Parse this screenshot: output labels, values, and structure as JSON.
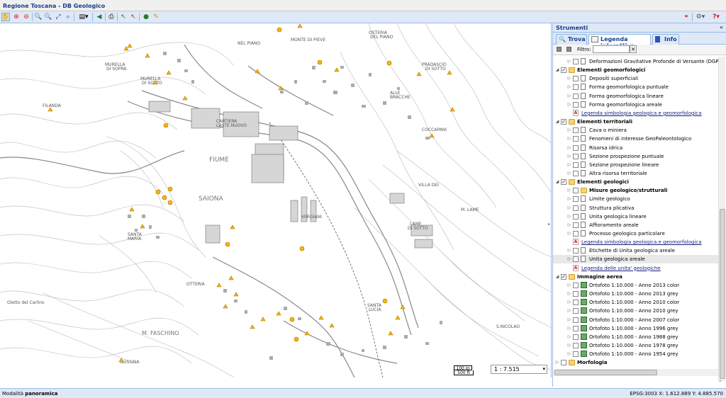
{
  "app": {
    "title": "Regione Toscana - DB Geologico"
  },
  "panel": {
    "title": "Strumenti",
    "tabs": [
      {
        "label": "Trova"
      },
      {
        "label": "Legenda interattiva"
      },
      {
        "label": "Info"
      }
    ],
    "filter_label": "Filtro:",
    "filter_value": "",
    "tree": [
      {
        "label": "Deformazioni Gravitative Profonde di Versante (DGPV)",
        "level": 2,
        "kind": "leaf",
        "expander": true
      },
      {
        "label": "Elementi geomorfologici",
        "level": 1,
        "kind": "folder",
        "checked": true,
        "bold": true,
        "expanded": true
      },
      {
        "label": "Depositi superficiali",
        "level": 2,
        "kind": "leaf",
        "expander": true
      },
      {
        "label": "Forma geomorfologica puntuale",
        "level": 2,
        "kind": "leaf",
        "expander": true
      },
      {
        "label": "Forma geomorfologica lineare",
        "level": 2,
        "kind": "leaf",
        "expander": true
      },
      {
        "label": "Forma geomorfologica areale",
        "level": 2,
        "kind": "leaf",
        "expander": true
      },
      {
        "label": "Legenda simbologia geologica e geomorfologica",
        "level": 2,
        "kind": "pdf",
        "link": true
      },
      {
        "label": "Elementi territoriali",
        "level": 1,
        "kind": "folder",
        "checked": true,
        "bold": true,
        "expanded": true
      },
      {
        "label": "Cava o miniera",
        "level": 2,
        "kind": "leaf",
        "expander": true
      },
      {
        "label": "Fenomeni di interesse GeoPaleontologico",
        "level": 2,
        "kind": "leaf",
        "expander": true
      },
      {
        "label": "Risorsa idrica",
        "level": 2,
        "kind": "leaf",
        "expander": true
      },
      {
        "label": "Sezione prospezione puntuale",
        "level": 2,
        "kind": "leaf",
        "expander": true
      },
      {
        "label": "Sezione prospezione lineare",
        "level": 2,
        "kind": "leaf",
        "expander": true
      },
      {
        "label": "Altra risorsa territoriale",
        "level": 2,
        "kind": "leaf",
        "expander": true
      },
      {
        "label": "Elementi geologici",
        "level": 1,
        "kind": "folder",
        "checked": true,
        "bold": true,
        "expanded": true
      },
      {
        "label": "Misure geologico/strutturali",
        "level": 2,
        "kind": "folder",
        "bold": true,
        "expander": true
      },
      {
        "label": "Limite geologico",
        "level": 2,
        "kind": "leaf",
        "expander": true
      },
      {
        "label": "Struttura plicativa",
        "level": 2,
        "kind": "leaf",
        "expander": true
      },
      {
        "label": "Unita geologica lineare",
        "level": 2,
        "kind": "leaf",
        "expander": true
      },
      {
        "label": "Affioramento areale",
        "level": 2,
        "kind": "leaf",
        "expander": true
      },
      {
        "label": "Processo geologico particolare",
        "level": 2,
        "kind": "leaf",
        "expander": true
      },
      {
        "label": "Legenda simbologia geologica e geomorfologica",
        "level": 2,
        "kind": "pdf",
        "link": true
      },
      {
        "label": "Etichette di Unita geologica areale",
        "level": 2,
        "kind": "leaf",
        "expander": true
      },
      {
        "label": "Unita geologica areale",
        "level": 2,
        "kind": "leaf",
        "expander": true,
        "selected": true
      },
      {
        "label": "Legenda delle unita' geologiche",
        "level": 2,
        "kind": "pdf",
        "link": true
      },
      {
        "label": "Immagine aerea",
        "level": 1,
        "kind": "folder",
        "checked": true,
        "bold": true,
        "expanded": true
      },
      {
        "label": "Ortofoto 1:10.000 - Anno 2013 color",
        "level": 2,
        "kind": "img",
        "expander": true
      },
      {
        "label": "Ortofoto 1:10.000 - Anno 2013 grey",
        "level": 2,
        "kind": "img",
        "expander": true
      },
      {
        "label": "Ortofoto 1:10.000 - Anno 2010 color",
        "level": 2,
        "kind": "img",
        "expander": true
      },
      {
        "label": "Ortofoto 1:10.000 - Anno 2010 grey",
        "level": 2,
        "kind": "img",
        "expander": true
      },
      {
        "label": "Ortofoto 1:10.000 - Anno 2007 color",
        "level": 2,
        "kind": "img",
        "expander": true
      },
      {
        "label": "Ortofoto 1:10.000 - Anno 1996 grey",
        "level": 2,
        "kind": "img",
        "expander": true
      },
      {
        "label": "Ortofoto 1:10.000 - Anno 1988 grey",
        "level": 2,
        "kind": "img",
        "expander": true
      },
      {
        "label": "Ortofoto 1:10.000 - Anno 1978 grey",
        "level": 2,
        "kind": "img",
        "expander": true
      },
      {
        "label": "Ortofoto 1:10.000 - Anno 1954 grey",
        "level": 2,
        "kind": "img",
        "expander": true
      },
      {
        "label": "Morfologia",
        "level": 1,
        "kind": "folder",
        "checked": false,
        "bold": true,
        "expanded": false
      }
    ]
  },
  "map": {
    "scale_ratio": "1 : 7.515",
    "scale_top": "100 m",
    "scale_bottom": "500 ft"
  },
  "status": {
    "mode_prefix": "Modalità",
    "mode_value": "panoramica",
    "coords": "EPSG:3003  X: 1.612.889  Y: 4.885.570"
  }
}
